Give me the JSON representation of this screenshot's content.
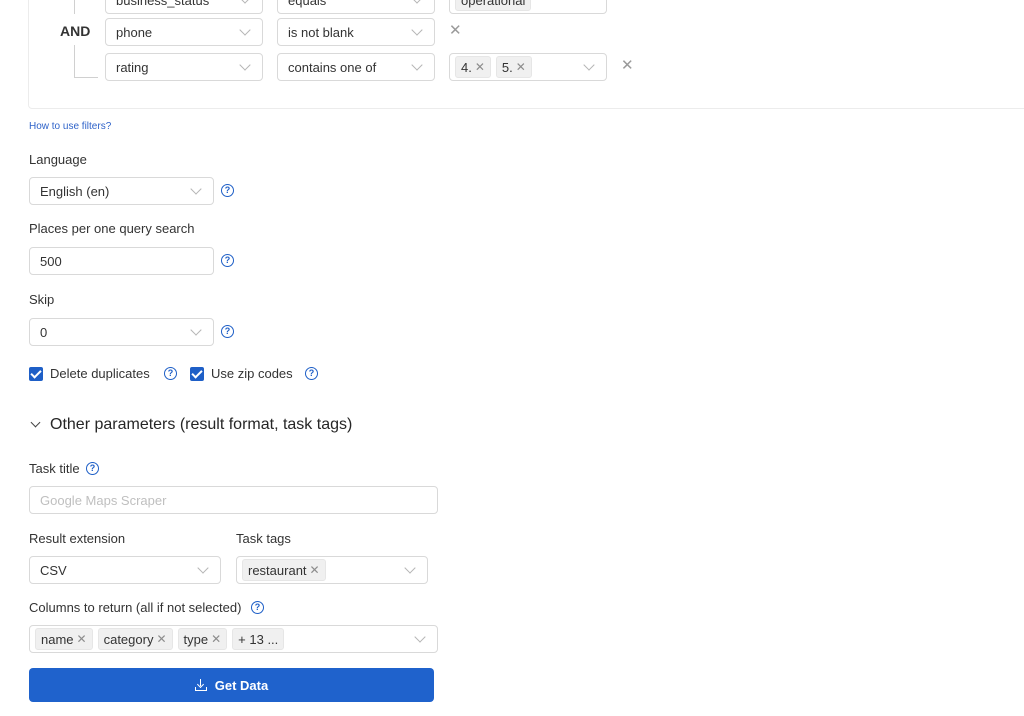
{
  "filters": {
    "operator": "AND",
    "rows": [
      {
        "field": "business_status",
        "condition": "equals",
        "values": [
          "operational"
        ]
      },
      {
        "field": "phone",
        "condition": "is not blank",
        "values": []
      },
      {
        "field": "rating",
        "condition": "contains one of",
        "values": [
          "4.",
          "5."
        ]
      }
    ],
    "help_link": "How to use filters?"
  },
  "language": {
    "label": "Language",
    "value": "English (en)"
  },
  "places_per_query": {
    "label": "Places per one query search",
    "value": "500"
  },
  "skip": {
    "label": "Skip",
    "value": "0"
  },
  "checkboxes": [
    {
      "label": "Delete duplicates",
      "checked": true
    },
    {
      "label": "Use zip codes",
      "checked": true
    }
  ],
  "other_params": {
    "title": "Other parameters (result format, task tags)"
  },
  "task_title": {
    "label": "Task title",
    "placeholder": "Google Maps Scraper"
  },
  "result_extension": {
    "label": "Result extension",
    "value": "CSV"
  },
  "task_tags": {
    "label": "Task tags",
    "tags": [
      "restaurant"
    ]
  },
  "columns": {
    "label": "Columns to return (all if not selected)",
    "tags": [
      "name",
      "category",
      "type"
    ],
    "more": "+ 13 ..."
  },
  "get_data_button": "Get Data",
  "colors": {
    "primary": "#1f62cc",
    "link": "#2f63c9"
  }
}
